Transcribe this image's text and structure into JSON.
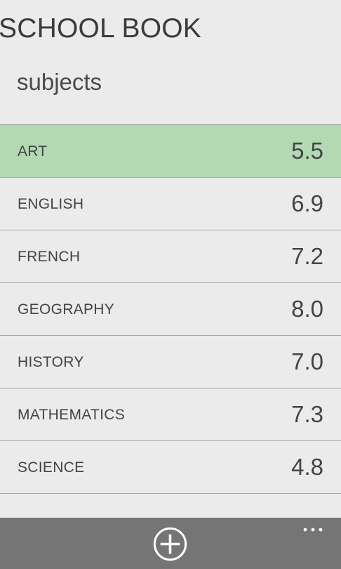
{
  "header": {
    "app_title": "SCHOOL BOOK",
    "section_title": "subjects"
  },
  "subjects": [
    {
      "name": "ART",
      "grade": "5.5",
      "selected": true
    },
    {
      "name": "ENGLISH",
      "grade": "6.9",
      "selected": false
    },
    {
      "name": "FRENCH",
      "grade": "7.2",
      "selected": false
    },
    {
      "name": "GEOGRAPHY",
      "grade": "8.0",
      "selected": false
    },
    {
      "name": "HISTORY",
      "grade": "7.0",
      "selected": false
    },
    {
      "name": "MATHEMATICS",
      "grade": "7.3",
      "selected": false
    },
    {
      "name": "SCIENCE",
      "grade": "4.8",
      "selected": false
    }
  ],
  "app_bar": {
    "add_icon": "add-circle-icon",
    "more_icon": "more-ellipsis-icon"
  },
  "colors": {
    "background": "#ebebeb",
    "selected_row": "#b3d9b3",
    "app_bar": "#757575",
    "text": "#444444",
    "divider": "#a7a7a7"
  }
}
